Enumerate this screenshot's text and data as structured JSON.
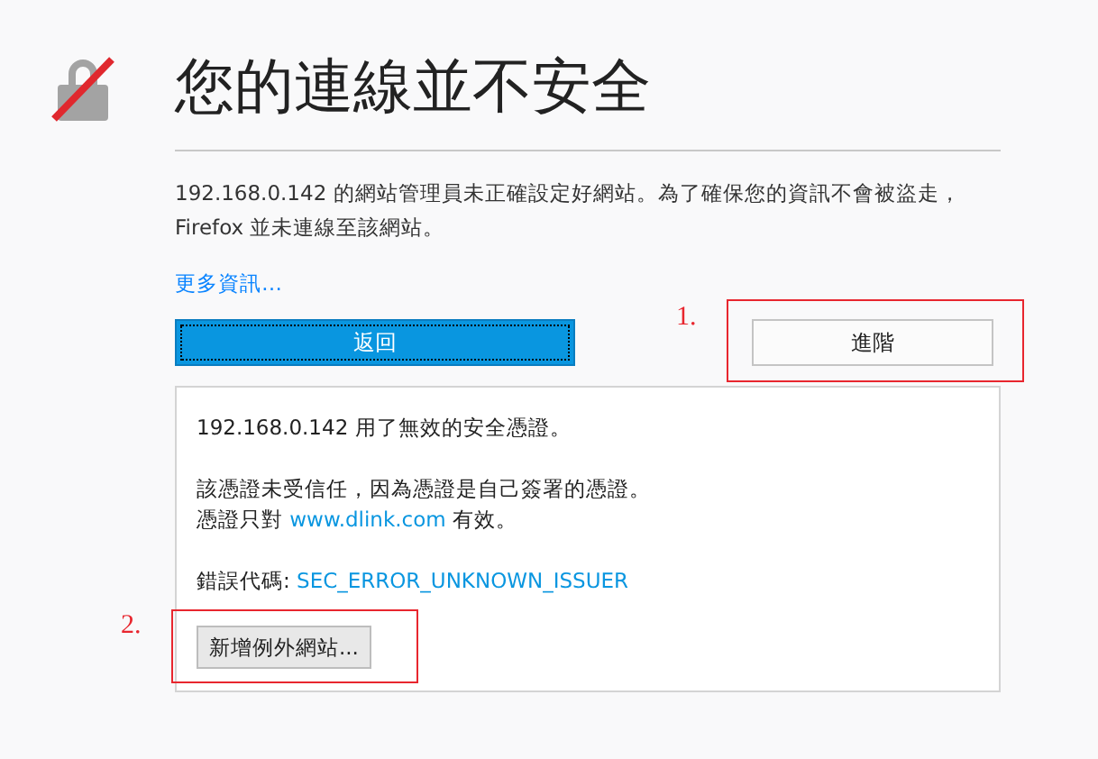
{
  "title": "您的連線並不安全",
  "description": "192.168.0.142 的網站管理員未正確設定好網站。為了確保您的資訊不會被盜走，Firefox 並未連線至該網站。",
  "learn_more_link": "更多資訊…",
  "back_button": "返回",
  "advanced_button": "進階",
  "details": {
    "invalid_cert": "192.168.0.142 用了無效的安全憑證。",
    "untrusted": "該憑證未受信任，因為憑證是自己簽署的憑證。",
    "valid_for": {
      "prefix": "憑證只對 ",
      "link": "www.dlink.com",
      "suffix": " 有效。"
    },
    "error_code": {
      "prefix": "錯誤代碼: ",
      "link": "SEC_ERROR_UNKNOWN_ISSUER"
    },
    "add_exception_button": "新增例外網站..."
  },
  "annotations": [
    {
      "label": "1."
    },
    {
      "label": "2."
    }
  ]
}
